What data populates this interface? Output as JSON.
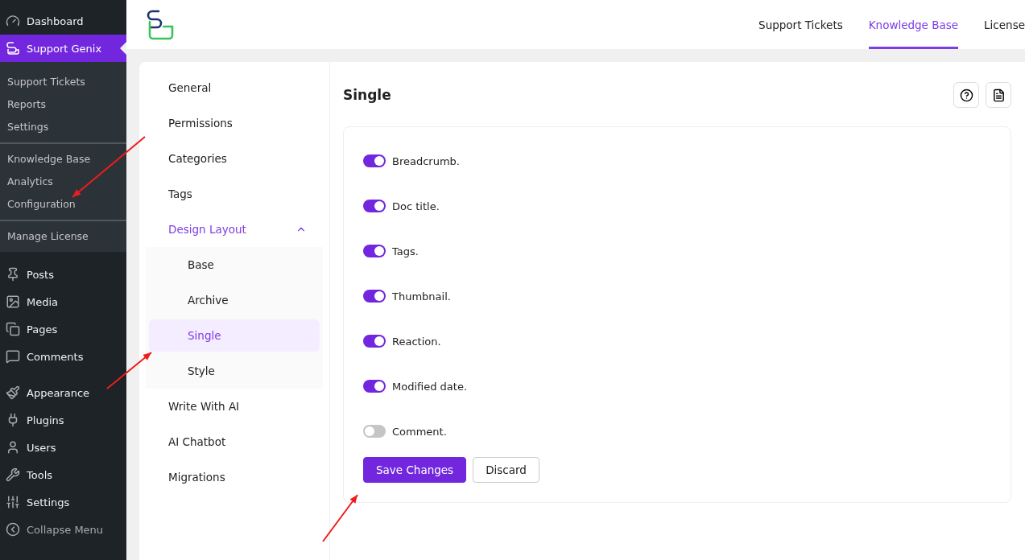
{
  "wp_menu": {
    "top": [
      {
        "label": "Dashboard"
      }
    ],
    "current": {
      "label": "Support Genix"
    },
    "submenu_groups": [
      [
        {
          "label": "Support Tickets"
        },
        {
          "label": "Reports"
        },
        {
          "label": "Settings"
        }
      ],
      [
        {
          "label": "Knowledge Base"
        },
        {
          "label": "Analytics"
        },
        {
          "label": "Configuration"
        }
      ],
      [
        {
          "label": "Manage License"
        }
      ]
    ],
    "items": [
      {
        "label": "Posts"
      },
      {
        "label": "Media"
      },
      {
        "label": "Pages"
      },
      {
        "label": "Comments"
      },
      {
        "label": "Appearance"
      },
      {
        "label": "Plugins"
      },
      {
        "label": "Users"
      },
      {
        "label": "Tools"
      },
      {
        "label": "Settings"
      }
    ],
    "collapse": "Collapse Menu"
  },
  "top_tabs": [
    {
      "label": "Support Tickets",
      "selected": false
    },
    {
      "label": "Knowledge Base",
      "selected": true
    },
    {
      "label": "License",
      "selected": false
    }
  ],
  "nav": [
    {
      "label": "General",
      "selected": false
    },
    {
      "label": "Permissions",
      "selected": false
    },
    {
      "label": "Categories",
      "selected": false
    },
    {
      "label": "Tags",
      "selected": false
    },
    {
      "label": "Design Layout",
      "selected": true,
      "expanded": true,
      "children": [
        {
          "label": "Base",
          "selected": false
        },
        {
          "label": "Archive",
          "selected": false
        },
        {
          "label": "Single",
          "selected": true
        },
        {
          "label": "Style",
          "selected": false
        }
      ]
    },
    {
      "label": "Write With AI",
      "selected": false
    },
    {
      "label": "AI Chatbot",
      "selected": false
    },
    {
      "label": "Migrations",
      "selected": false
    }
  ],
  "panel": {
    "title": "Single",
    "settings": [
      {
        "label": "Breadcrumb.",
        "on": true
      },
      {
        "label": "Doc title.",
        "on": true
      },
      {
        "label": "Tags.",
        "on": true
      },
      {
        "label": "Thumbnail.",
        "on": true
      },
      {
        "label": "Reaction.",
        "on": true
      },
      {
        "label": "Modified date.",
        "on": true
      },
      {
        "label": "Comment.",
        "on": false
      }
    ],
    "buttons": [
      {
        "label": "Save Changes",
        "kind": "primary"
      },
      {
        "label": "Discard",
        "kind": "secondary"
      }
    ]
  }
}
